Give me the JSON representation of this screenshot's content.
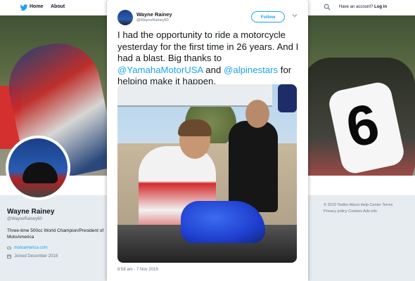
{
  "topbar": {
    "home": "Home",
    "about": "About",
    "account_prefix": "Have an account?",
    "login": "Log in"
  },
  "profile": {
    "name": "Wayne Rainey",
    "handle": "@WayneRainey60",
    "bio": "Three-time 500cc World Champion/President of MotoAmerica",
    "website": "motoamerica.com",
    "joined": "Joined December 2018"
  },
  "footer": {
    "line1": "© 2019 Twitter   About   Help Center   Terms",
    "line2": "Privacy policy   Cookies   Ads info"
  },
  "tweet": {
    "author_name": "Wayne Rainey",
    "author_handle": "@WayneRainey60",
    "follow_label": "Follow",
    "text_part1": "I had the opportunity to ride a motorcycle yesterday for the first time in 26 years. And I had a blast. Big thanks to ",
    "mention1": "@YamahaMotorUSA",
    "text_part2": " and ",
    "mention2": "@alpinestars",
    "text_part3": " for helping make it happen.",
    "timestamp": "8:58 am - 7 Nov 2019",
    "plate_number": "6"
  },
  "colors": {
    "accent": "#1da1f2",
    "text": "#14171a",
    "muted": "#657786"
  }
}
